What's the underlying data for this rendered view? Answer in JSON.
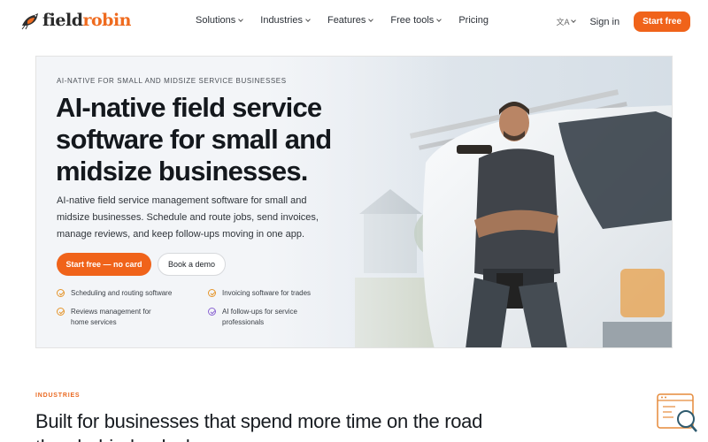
{
  "nav": {
    "logo_part1": "field",
    "logo_part2": "robin",
    "menu": [
      {
        "label": "Solutions",
        "dropdown": true
      },
      {
        "label": "Industries",
        "dropdown": true
      },
      {
        "label": "Features",
        "dropdown": true
      },
      {
        "label": "Free tools",
        "dropdown": true
      },
      {
        "label": "Pricing",
        "dropdown": false
      }
    ],
    "language_label": "文A",
    "sign_in": "Sign in",
    "start_free": "Start free"
  },
  "hero": {
    "eyebrow": "AI-NATIVE FOR SMALL AND MIDSIZE SERVICE BUSINESSES",
    "title": "AI-native field service software for small and midsize businesses.",
    "lead": "AI-native field service management software for small and midsize businesses. Schedule and route jobs, send invoices, manage reviews, and keep follow-ups moving in one app.",
    "cta_primary": "Start free — no card",
    "cta_secondary": "Book a demo",
    "features": [
      {
        "label": "Scheduling and routing software",
        "icon": "check-circle-icon"
      },
      {
        "label": "Invoicing software for trades",
        "icon": "check-circle-icon"
      },
      {
        "label": "Reviews management for home services",
        "icon": "check-circle-icon"
      },
      {
        "label": "AI follow-ups for service professionals",
        "icon": "check-circle-icon"
      }
    ]
  },
  "section": {
    "eyebrow": "INDUSTRIES",
    "title_line1": "Built for businesses that spend more time on the road",
    "title_line2": "than behind a desk."
  },
  "colors": {
    "accent": "#f0631a",
    "check": "#e5952b",
    "ai_check": "#8a63d2"
  },
  "icons": {
    "logo": "robin-bird-icon",
    "widget": "document-search-icon"
  }
}
